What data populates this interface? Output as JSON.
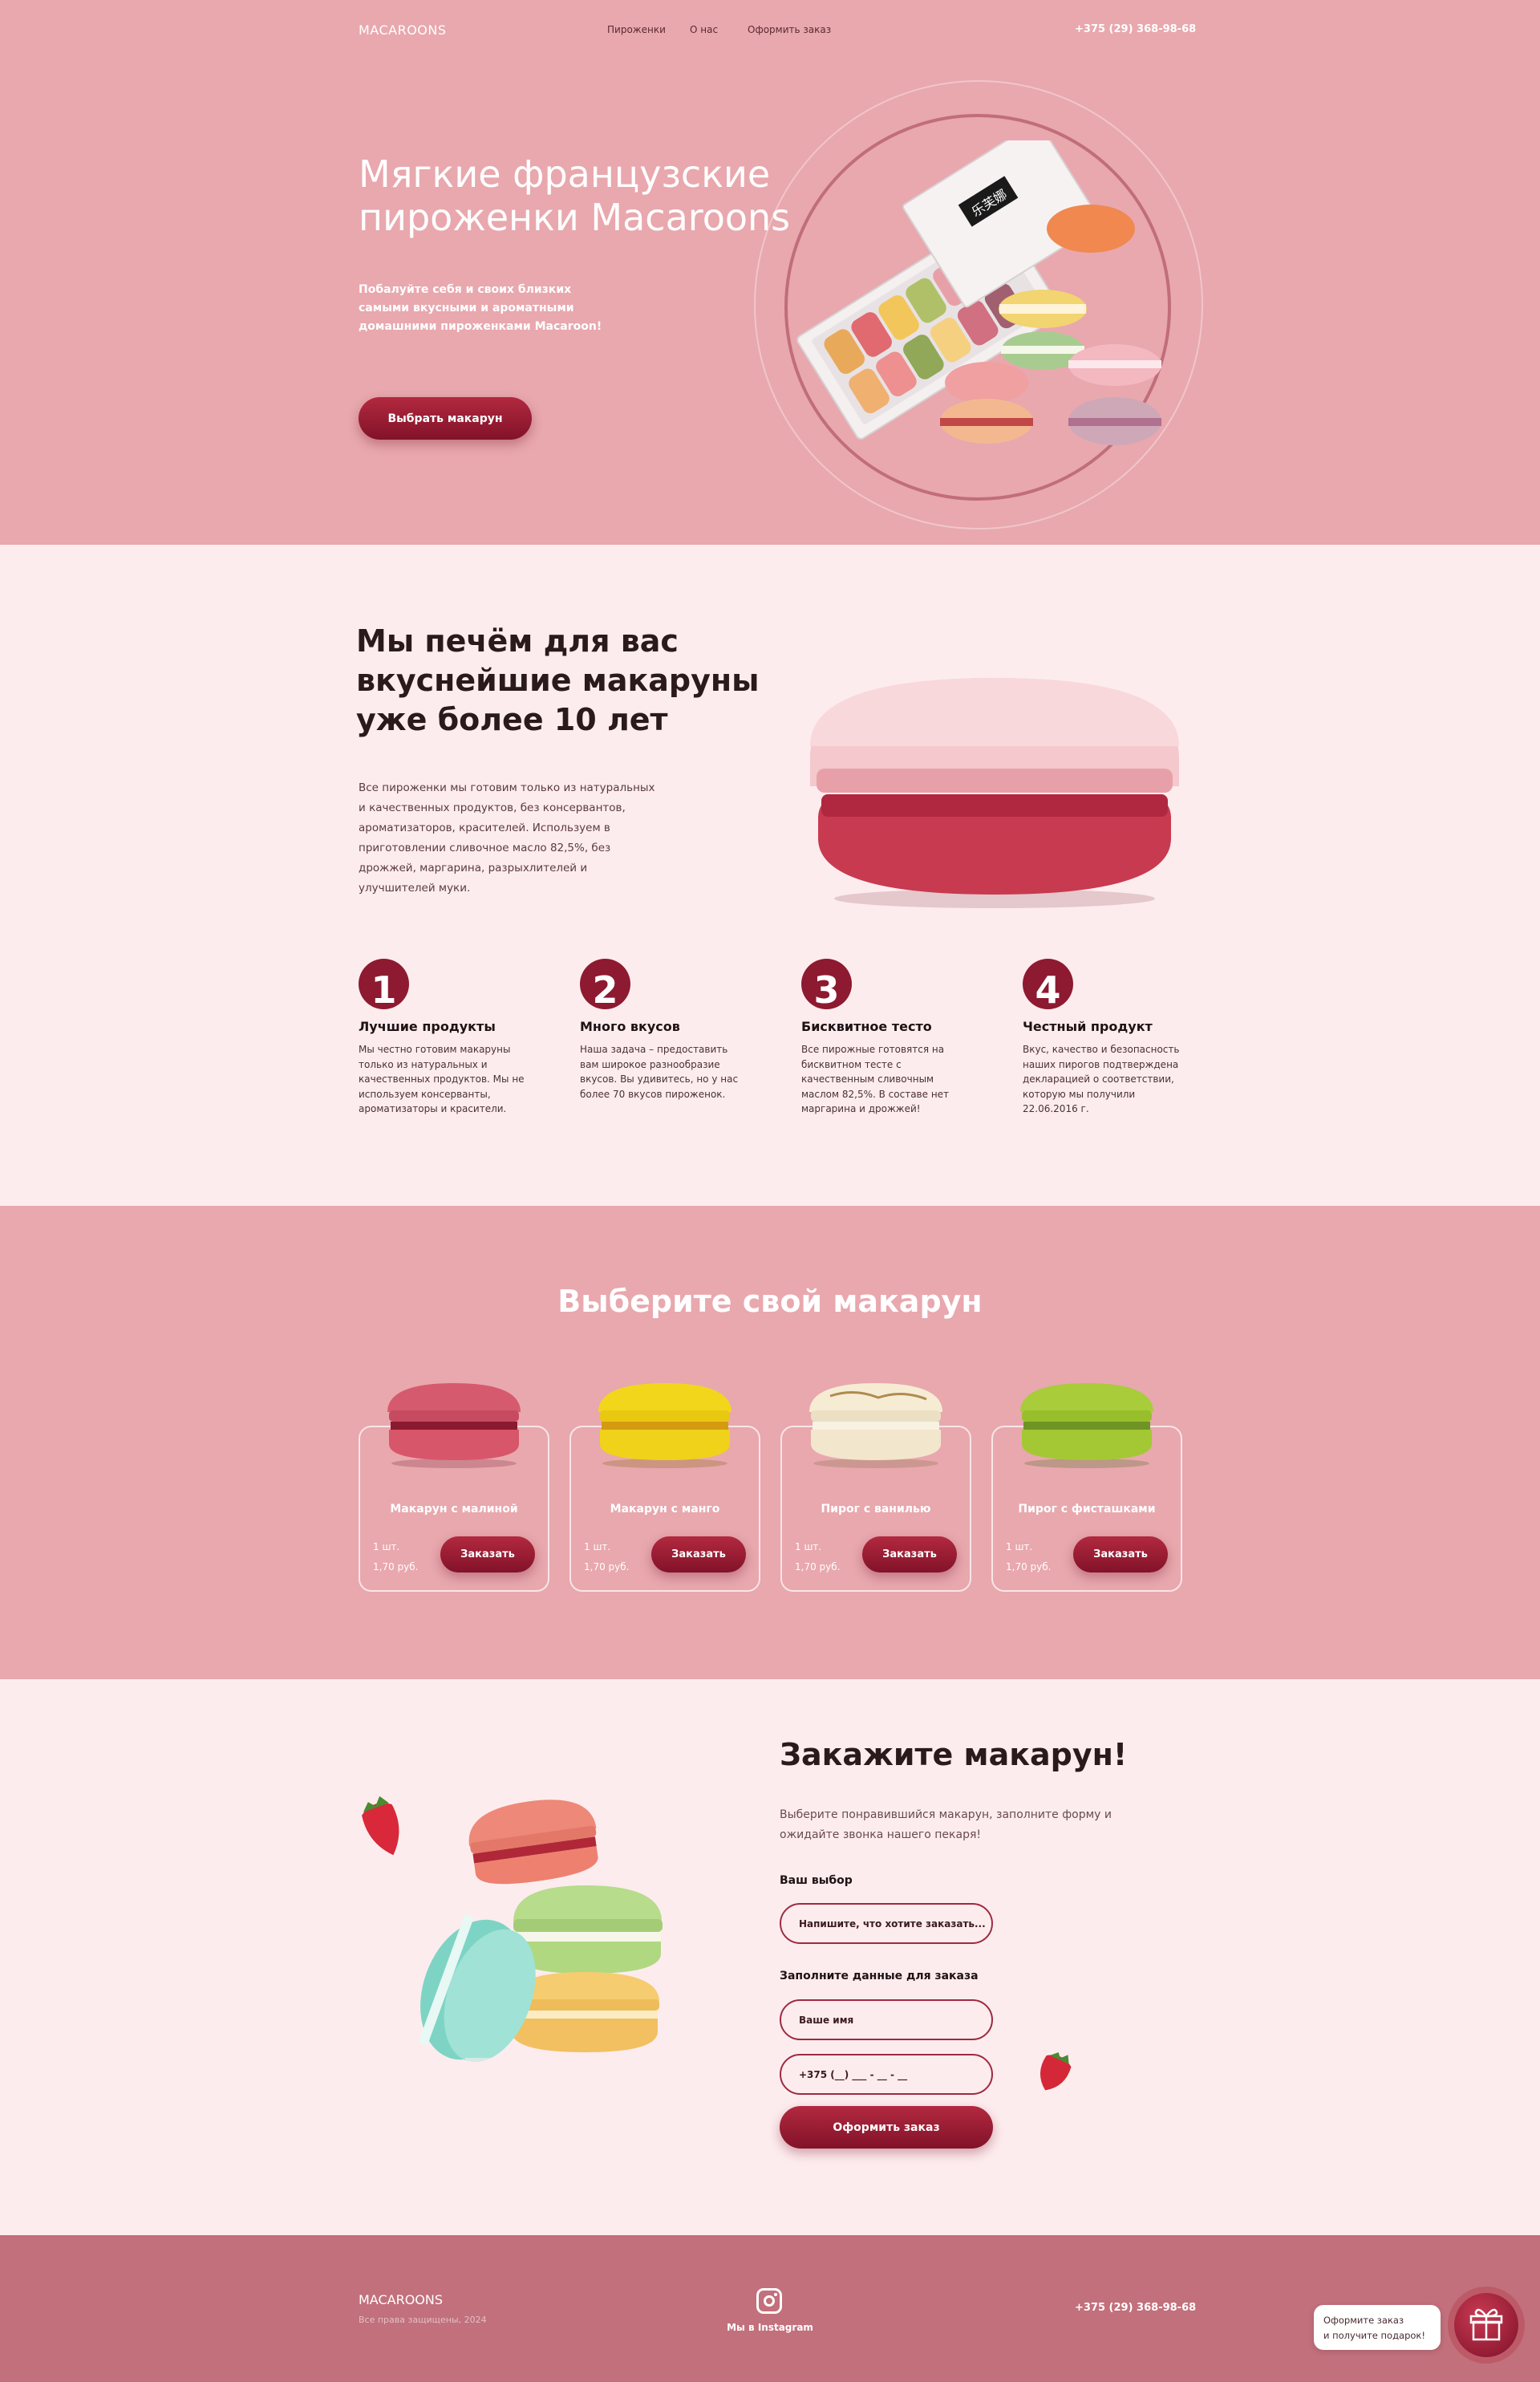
{
  "header": {
    "logo": "MACAROONS",
    "nav": [
      "Пироженки",
      "О нас",
      "Оформить заказ"
    ],
    "phone": "+375 (29) 368-98-68"
  },
  "hero": {
    "title": "Мягкие французские пироженки Macaroons",
    "subtitle": "Побалуйте себя и своих близких самыми вкусными и ароматными домашними пироженками Macaroon!",
    "cta": "Выбрать макарун",
    "box_label": "乐芙娜"
  },
  "about": {
    "title": "Мы печём для вас вкуснейшие макаруны уже более 10 лет",
    "text": "Все пироженки мы готовим только из натуральных и качественных продуктов, без консервантов, ароматизаторов, красителей. Используем в приготовлении сливочное масло 82,5%, без дрожжей, маргарина, разрыхлителей и улучшителей муки.",
    "features": [
      {
        "num": "1",
        "title": "Лучшие продукты",
        "text": "Мы честно готовим макаруны только из натуральных и качественных продуктов. Мы не используем консерванты, ароматизаторы и красители."
      },
      {
        "num": "2",
        "title": "Много вкусов",
        "text": "Наша задача – предоставить вам широкое разнообразие вкусов. Вы удивитесь, но у нас более 70 вкусов пироженок."
      },
      {
        "num": "3",
        "title": "Бисквитное тесто",
        "text": "Все пирожные готовятся на бисквитном тесте с качественным сливочным маслом 82,5%. В составе нет маргарина и дрожжей!"
      },
      {
        "num": "4",
        "title": "Честный продукт",
        "text": "Вкус, качество и безопасность наших пирогов подтверждена декларацией о соответствии, которую мы получили 22.06.2016 г."
      }
    ]
  },
  "choose": {
    "title": "Выберите свой макарун",
    "products": [
      {
        "name": "Макарун с малиной",
        "qty": "1 шт.",
        "price": "1,70 руб.",
        "button": "Заказать"
      },
      {
        "name": "Макарун с манго",
        "qty": "1 шт.",
        "price": "1,70 руб.",
        "button": "Заказать"
      },
      {
        "name": "Пирог с ванилью",
        "qty": "1 шт.",
        "price": "1,70 руб.",
        "button": "Заказать"
      },
      {
        "name": "Пирог с фисташками",
        "qty": "1 шт.",
        "price": "1,70 руб.",
        "button": "Заказать"
      }
    ]
  },
  "order": {
    "title": "Закажите макарун!",
    "subtitle": "Выберите понравившийся макарун, заполните форму и ожидайте звонка нашего пекаря!",
    "choice_label": "Ваш выбор",
    "choice_placeholder": "Напишите, что хотите заказать...",
    "data_label": "Заполните данные для заказа",
    "name_placeholder": "Ваше имя",
    "phone_placeholder": "+375 (__) ___ - __ - __",
    "submit": "Оформить заказ"
  },
  "footer": {
    "logo": "MACAROONS",
    "rights": "Все права защищены, 2024",
    "instagram": "Мы в Instagram",
    "phone": "+375 (29) 368-98-68",
    "gift_line1": "Оформите заказ",
    "gift_line2": "и получите подарок!"
  },
  "colors": {
    "hero_bg": "#e8a8ae",
    "page_bg": "#fdecee",
    "accent": "#8d1a30",
    "footer_bg": "#c2707c"
  }
}
